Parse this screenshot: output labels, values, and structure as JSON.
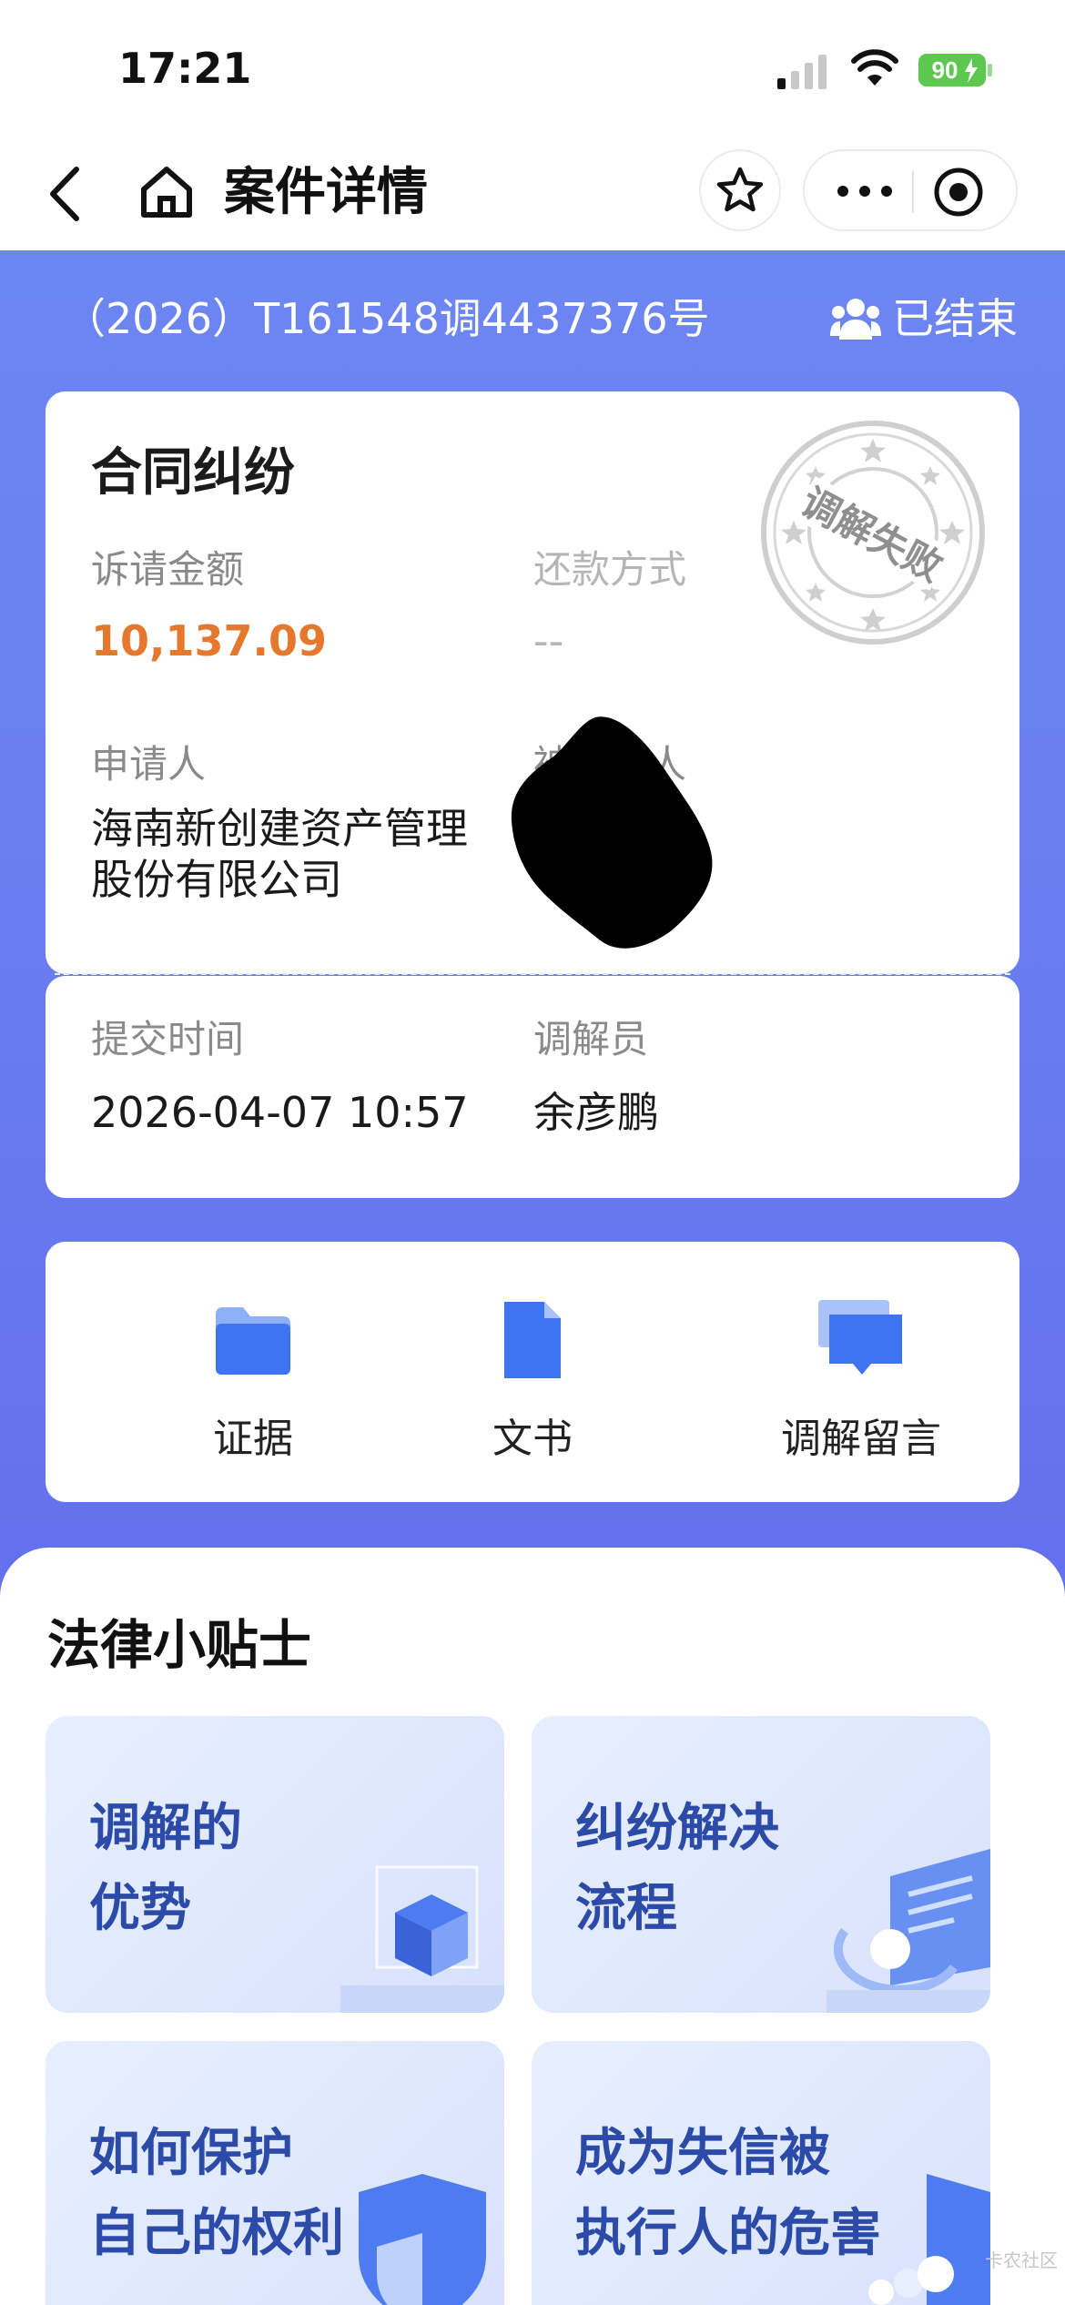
{
  "status_bar": {
    "time": "17:21",
    "battery": "90"
  },
  "nav": {
    "title": "案件详情"
  },
  "case": {
    "number": "（2026）T161548调4437376号",
    "status": "已结束",
    "type": "合同纠纷",
    "stamp_text": "调解失败",
    "claim_amount_label": "诉请金额",
    "claim_amount": "10,137.09",
    "repayment_label": "还款方式",
    "repayment_value": "--",
    "applicant_label": "申请人",
    "applicant": "海南新创建资产管理\n股份有限公司",
    "respondent_label": "被申请人",
    "submit_time_label": "提交时间",
    "submit_time": "2026-04-07 10:57",
    "mediator_label": "调解员",
    "mediator": "余彦鹏"
  },
  "actions": [
    {
      "label": "证据",
      "icon": "folder-icon"
    },
    {
      "label": "文书",
      "icon": "document-icon"
    },
    {
      "label": "调解留言",
      "icon": "message-icon"
    }
  ],
  "tips": {
    "title": "法律小贴士",
    "items": [
      {
        "text": "调解的\n优势"
      },
      {
        "text": "纠纷解决\n流程"
      },
      {
        "text": "如何保护\n自己的权利"
      },
      {
        "text": "成为失信被\n执行人的危害"
      }
    ]
  },
  "watermark": "卡农社区",
  "colors": {
    "header_blue": "#6a80f0",
    "amount_orange": "#e6782e",
    "icon_blue": "#3f74f0",
    "tip_text_blue": "#2c4ba8"
  }
}
